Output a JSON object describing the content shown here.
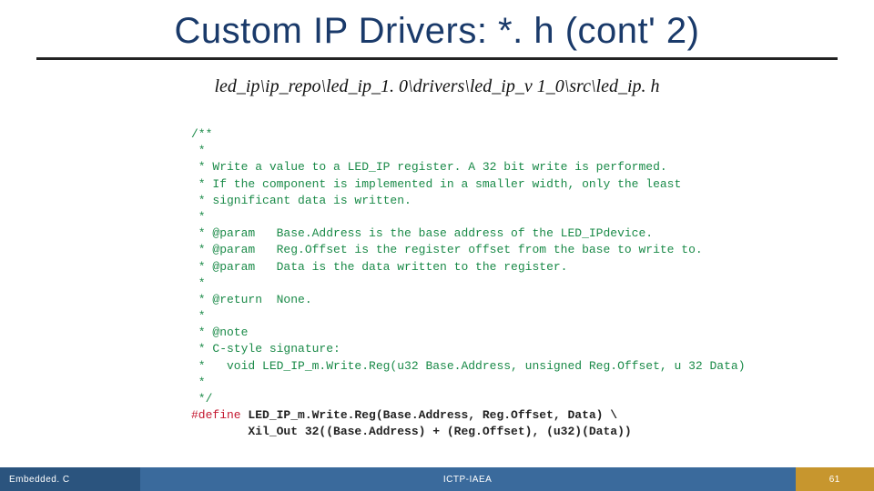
{
  "title": "Custom IP Drivers: *. h (cont' 2)",
  "subtitle": "led_ip\\ip_repo\\led_ip_1. 0\\drivers\\led_ip_v 1_0\\src\\led_ip. h",
  "code": {
    "c01": "/**",
    "c02": " *",
    "c03": " * Write a value to a LED_IP register. A 32 bit write is performed.",
    "c04": " * If the component is implemented in a smaller width, only the least",
    "c05": " * significant data is written.",
    "c06": " *",
    "c07": " * @param   Base.Address is the base address of the LED_IPdevice.",
    "c08": " * @param   Reg.Offset is the register offset from the base to write to.",
    "c09": " * @param   Data is the data written to the register.",
    "c10": " *",
    "c11": " * @return  None.",
    "c12": " *",
    "c13": " * @note",
    "c14": " * C-style signature:",
    "c15": " *   void LED_IP_m.Write.Reg(u32 Base.Address, unsigned Reg.Offset, u 32 Data)",
    "c16": " *",
    "c17": " */",
    "kw": "#define",
    "d1": " LED_IP_m.Write.Reg(Base.Address, Reg.Offset, Data) \\",
    "d2": "        Xil_Out 32((Base.Address) + (Reg.Offset), (u32)(Data))"
  },
  "footer": {
    "left": "Embedded. C",
    "center": "ICTP-IAEA",
    "right": "61"
  }
}
